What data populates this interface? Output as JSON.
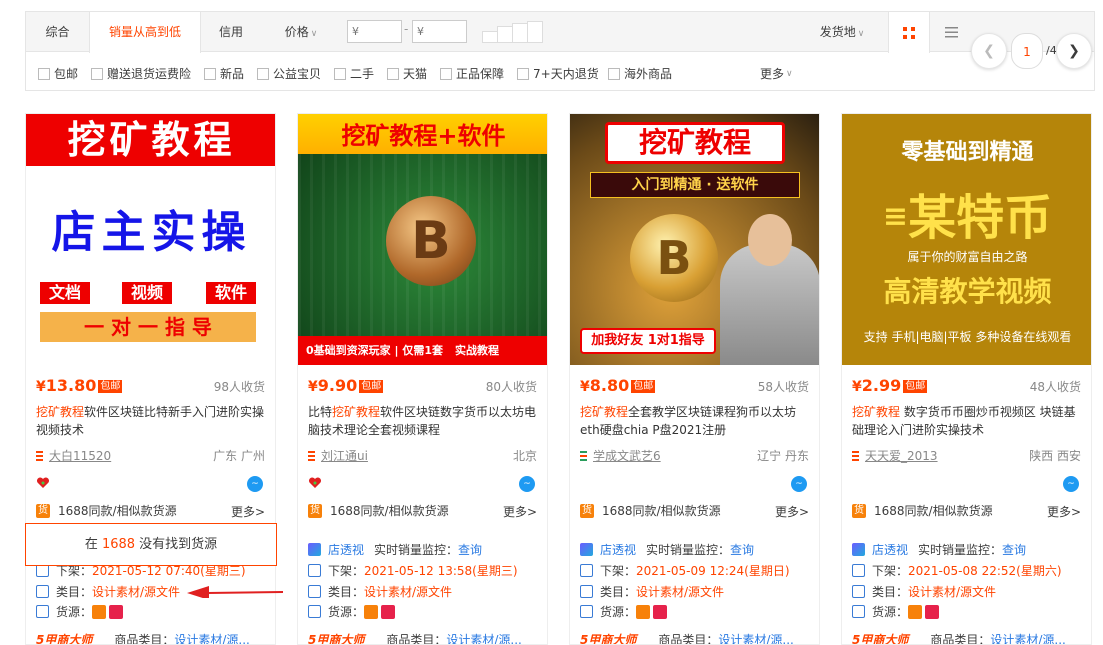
{
  "sort_tabs": {
    "comprehensive": "综合",
    "sales_desc": "销量从高到低",
    "credit": "信用",
    "price": "价格"
  },
  "price_filter": {
    "min_placeholder": "¥",
    "max_placeholder": "¥",
    "separator": "-"
  },
  "ship_from": "发货地",
  "filters": [
    "包邮",
    "赠送退货运费险",
    "新品",
    "公益宝贝",
    "二手",
    "天猫",
    "正品保障",
    "7+天内退货",
    "海外商品"
  ],
  "more_label": "更多",
  "pager": {
    "current": "1",
    "total": "/4"
  },
  "cards": [
    {
      "price_yen": "¥",
      "price": "13.80",
      "badge": "包邮",
      "sold": "98人收货",
      "title_hl": "挖矿教程",
      "title_rest": "软件区块链比特新手入门进阶实操视频技术",
      "shop": "大白11520",
      "location": "广东 广州",
      "source_label": "1688同款/相似款货源",
      "more": "更多>",
      "thumb": {
        "top": "挖矿教程",
        "mid": "店主实操",
        "tags": [
          "文档",
          "视频",
          "软件"
        ],
        "bottom": "一 对 一 指 导"
      }
    },
    {
      "price_yen": "¥",
      "price": "9.90",
      "badge": "包邮",
      "sold": "80人收货",
      "title_pre": "比特",
      "title_hl": "挖矿教程",
      "title_rest": "软件区块链数字货币以太坊电脑技术理论全套视频课程",
      "shop": "刘江通ui",
      "location": "北京",
      "source_label": "1688同款/相似款货源",
      "more": "更多>",
      "monitor": {
        "tool": "店透视",
        "label": "实时销量监控：",
        "link": "查询"
      },
      "listed": {
        "label": "下架：",
        "value": "2021-05-12 13:58(星期三)"
      },
      "category": {
        "label": "类目：",
        "value": "设计素材/源文件"
      },
      "goods_src": {
        "label": "货源："
      },
      "bottom": {
        "logo": "5甲商大师",
        "label": "商品类目：",
        "link": "设计素材/源..."
      },
      "thumb": {
        "top": "挖矿教程+软件",
        "bottom": "0基础到资深玩家 | 仅需1套",
        "tag": "实战教程"
      }
    },
    {
      "price_yen": "¥",
      "price": "8.80",
      "badge": "包邮",
      "sold": "58人收货",
      "title_hl": "挖矿教程",
      "title_rest": "全套教学区块链课程狗币以太坊eth硬盘chia P盘2021注册",
      "shop": "学成文武艺6",
      "location": "辽宁 丹东",
      "source_label": "1688同款/相似款货源",
      "more": "更多>",
      "monitor": {
        "tool": "店透视",
        "label": "实时销量监控：",
        "link": "查询"
      },
      "listed": {
        "label": "下架：",
        "value": "2021-05-09 12:24(星期日)"
      },
      "category": {
        "label": "类目：",
        "value": "设计素材/源文件"
      },
      "goods_src": {
        "label": "货源："
      },
      "bottom": {
        "logo": "5甲商大师",
        "label": "商品类目：",
        "link": "设计素材/源..."
      },
      "thumb": {
        "top": "挖矿教程",
        "sub": "入门到精通 · 送软件",
        "bottom": "加我好友 1对1指导"
      }
    },
    {
      "price_yen": "¥",
      "price": "2.99",
      "badge": "包邮",
      "sold": "48人收货",
      "title_hl": "挖矿教程",
      "title_rest": " 数字货币币圈炒币视频区 块链基础理论入门进阶实操技术",
      "shop": "天天爱_2013",
      "location": "陕西 西安",
      "source_label": "1688同款/相似款货源",
      "more": "更多>",
      "monitor": {
        "tool": "店透视",
        "label": "实时销量监控：",
        "link": "查询"
      },
      "listed": {
        "label": "下架：",
        "value": "2021-05-08 22:52(星期六)"
      },
      "category": {
        "label": "类目：",
        "value": "设计素材/源文件"
      },
      "goods_src": {
        "label": "货源："
      },
      "bottom": {
        "logo": "5甲商大师",
        "label": "商品类目：",
        "link": "设计素材/源..."
      },
      "thumb": {
        "top": "零基础到精通",
        "mid": "某特币",
        "sub": "属于你的财富自由之路",
        "big": "高清教学视频",
        "bottom": "支持 手机|电脑|平板 多种设备在线观看"
      }
    }
  ],
  "card1_extra": {
    "listed": {
      "label": "下架：",
      "value": "2021-05-12 07:40(星期三)"
    },
    "category": {
      "label": "类目：",
      "value": "设计素材/源文件"
    },
    "goods_src": {
      "label": "货源："
    },
    "bottom": {
      "logo": "5甲商大师",
      "label": "商品类目：",
      "link": "设计素材/源..."
    }
  },
  "popup": {
    "pre": "在 ",
    "hl": "1688",
    "post": " 没有找到货源"
  },
  "colors": {
    "accent": "#ff4400",
    "link": "#2a7ae2"
  }
}
